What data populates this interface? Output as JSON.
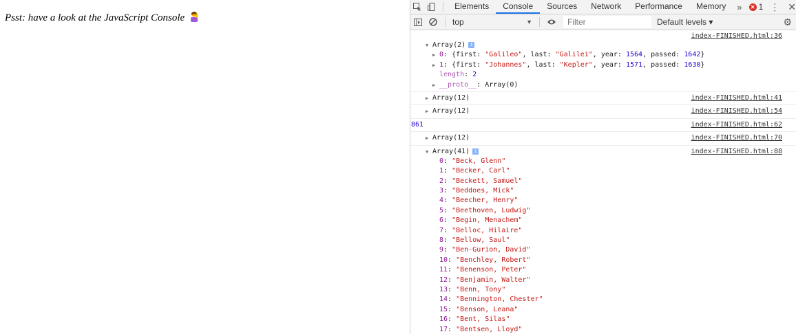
{
  "page": {
    "message": "Psst: have a look at the JavaScript Console"
  },
  "devtools": {
    "tabs": [
      "Elements",
      "Console",
      "Sources",
      "Network",
      "Performance",
      "Memory"
    ],
    "more": "»",
    "error_count": "1",
    "toolbar": {
      "context": "top",
      "filter_placeholder": "Filter",
      "levels": "Default levels ▾"
    }
  },
  "console": {
    "entry1": {
      "location": "index-FINISHED.html:36",
      "header": "Array(2)",
      "items": [
        {
          "key": "0",
          "first": "\"Galileo\"",
          "last": "\"Galilei\"",
          "year": "1564",
          "passed": "1642"
        },
        {
          "key": "1",
          "first": "\"Johannes\"",
          "last": "\"Kepler\"",
          "year": "1571",
          "passed": "1630"
        }
      ],
      "length_label": "length",
      "length_value": "2",
      "proto_label": "__proto__",
      "proto_value": "Array(0)"
    },
    "entry2": {
      "location": "index-FINISHED.html:41",
      "text": "Array(12)"
    },
    "entry3": {
      "location": "index-FINISHED.html:54",
      "text": "Array(12)"
    },
    "entry4": {
      "location": "index-FINISHED.html:62",
      "text": "861"
    },
    "entry5": {
      "location": "index-FINISHED.html:70",
      "text": "Array(12)"
    },
    "entry6": {
      "location": "index-FINISHED.html:88",
      "header": "Array(41)",
      "items": [
        {
          "k": "0",
          "v": "\"Beck, Glenn\""
        },
        {
          "k": "1",
          "v": "\"Becker, Carl\""
        },
        {
          "k": "2",
          "v": "\"Beckett, Samuel\""
        },
        {
          "k": "3",
          "v": "\"Beddoes, Mick\""
        },
        {
          "k": "4",
          "v": "\"Beecher, Henry\""
        },
        {
          "k": "5",
          "v": "\"Beethoven, Ludwig\""
        },
        {
          "k": "6",
          "v": "\"Begin, Menachem\""
        },
        {
          "k": "7",
          "v": "\"Belloc, Hilaire\""
        },
        {
          "k": "8",
          "v": "\"Bellow, Saul\""
        },
        {
          "k": "9",
          "v": "\"Ben-Gurion, David\""
        },
        {
          "k": "10",
          "v": "\"Benchley, Robert\""
        },
        {
          "k": "11",
          "v": "\"Benenson, Peter\""
        },
        {
          "k": "12",
          "v": "\"Benjamin, Walter\""
        },
        {
          "k": "13",
          "v": "\"Benn, Tony\""
        },
        {
          "k": "14",
          "v": "\"Bennington, Chester\""
        },
        {
          "k": "15",
          "v": "\"Benson, Leana\""
        },
        {
          "k": "16",
          "v": "\"Bent, Silas\""
        },
        {
          "k": "17",
          "v": "\"Bentsen, Lloyd\""
        }
      ]
    }
  },
  "icons": [
    "inspect-icon",
    "device-toolbar-icon",
    "sidebar-toggle-icon",
    "clear-console-icon",
    "eye-icon",
    "settings-gear-icon",
    "kebab-menu-icon",
    "close-icon",
    "error-icon",
    "info-icon",
    "emoji-person-icon"
  ]
}
